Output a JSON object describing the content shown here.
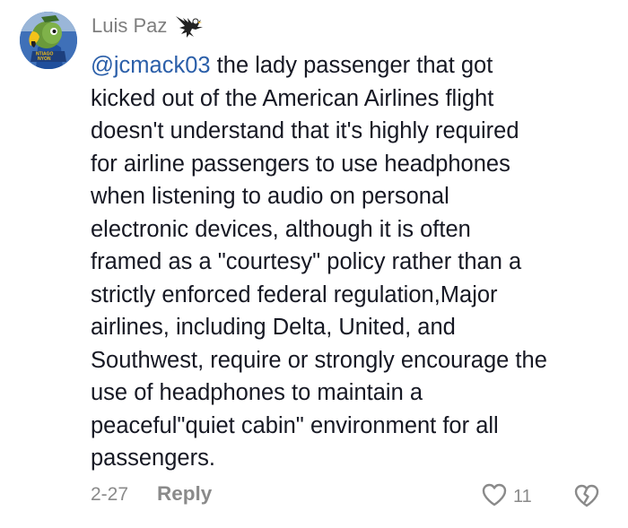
{
  "comment": {
    "username": "Luis Paz",
    "user_badge_icon": "eagle-icon",
    "mention": "@jcmack03",
    "text": " the lady passenger that got\nkicked out of the American Airlines flight\ndoesn't understand that it's highly required\nfor airline passengers to use headphones\nwhen listening to audio on personal\nelectronic devices, although it is often\nframed as a \"courtesy\" policy rather than a\nstrictly enforced federal regulation,Major\nairlines, including Delta, United, and\nSouthwest, require or strongly encourage the\nuse of headphones to maintain a\npeaceful\"quiet cabin\" environment for all\npassengers.",
    "date": "2-27",
    "reply_label": "Reply",
    "like_count": "11",
    "like_icon": "heart-outline-icon",
    "dislike_icon": "broken-heart-icon"
  },
  "colors": {
    "mention": "#2b5fa9",
    "text": "#161823",
    "muted": "#8a8a8a"
  }
}
